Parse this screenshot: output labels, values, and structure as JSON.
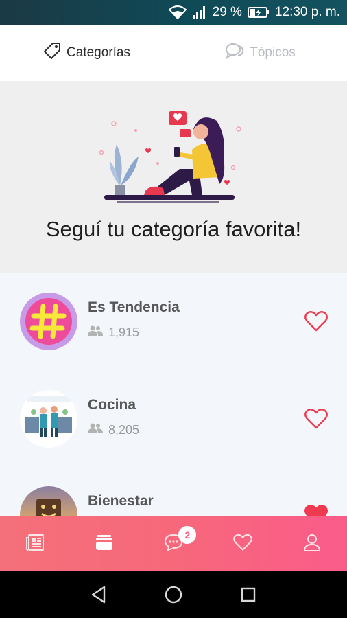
{
  "status_bar": {
    "battery_percent": "29 %",
    "time": "12:30 p. m.",
    "icons": [
      "wifi-icon",
      "signal-icon",
      "battery-charging-icon"
    ]
  },
  "tabs": [
    {
      "label": "Categorías",
      "icon": "tag-icon",
      "active": true
    },
    {
      "label": "Tópicos",
      "icon": "chat-bubbles-icon",
      "active": false
    }
  ],
  "hero": {
    "title": "Seguí tu categoría favorita!",
    "illustration": "woman-with-phone-illustration"
  },
  "categories": [
    {
      "name": "Es Tendencia",
      "followers": "1,915",
      "image": "hashtag-image",
      "favorited": false
    },
    {
      "name": "Cocina",
      "followers": "8,205",
      "image": "kitchen-chefs-image",
      "favorited": false
    },
    {
      "name": "Bienestar",
      "followers": "",
      "image": "wellness-image",
      "favorited": true
    }
  ],
  "bottom_nav": {
    "items": [
      {
        "icon": "newspaper-icon",
        "active": false
      },
      {
        "icon": "categories-icon",
        "active": true
      },
      {
        "icon": "chat-icon",
        "badge": "2",
        "active": false
      },
      {
        "icon": "heart-icon",
        "active": false
      },
      {
        "icon": "profile-icon",
        "active": false
      }
    ]
  },
  "colors": {
    "accent": "#f7687b",
    "heart": "#f03a4f",
    "status_bar": "#0f4a57"
  }
}
